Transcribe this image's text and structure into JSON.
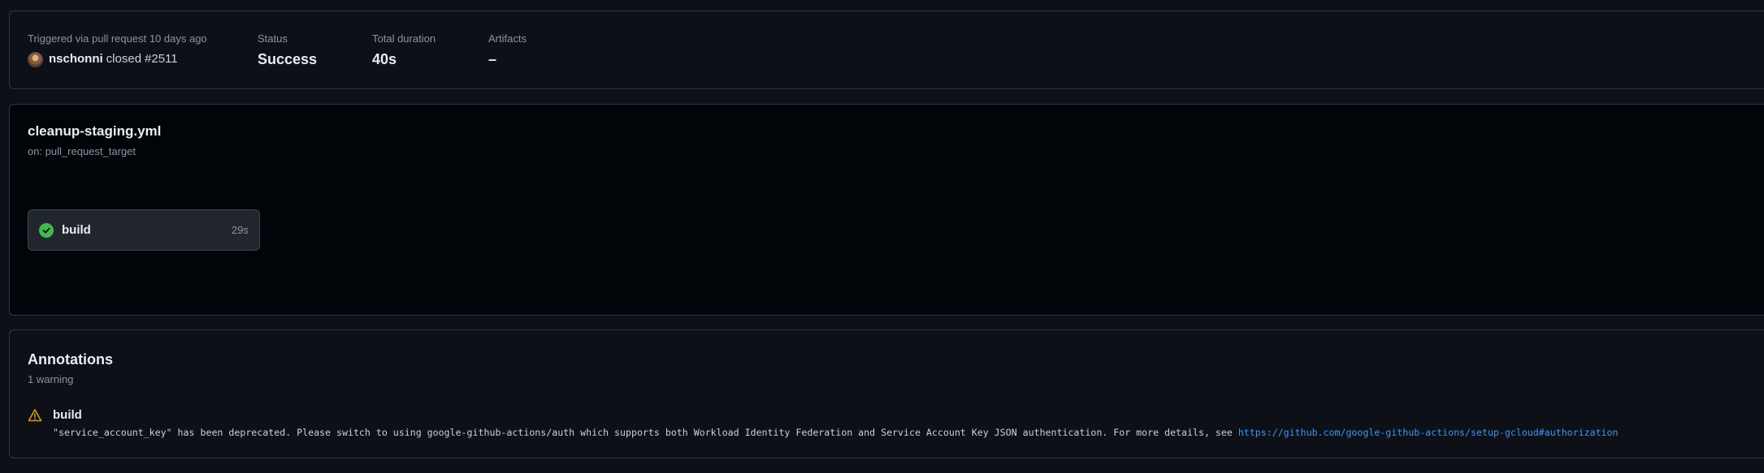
{
  "summary": {
    "trigger_label": "Triggered via pull request 10 days ago",
    "actor": "nschonni",
    "action": "closed",
    "pr_ref": "#2511",
    "status_label": "Status",
    "status_value": "Success",
    "duration_label": "Total duration",
    "duration_value": "40s",
    "artifacts_label": "Artifacts",
    "artifacts_value": "–"
  },
  "workflow": {
    "file_name": "cleanup-staging.yml",
    "trigger": "on: pull_request_target",
    "jobs": [
      {
        "name": "build",
        "duration": "29s",
        "status": "success",
        "icon": "check-circle-fill-icon"
      }
    ]
  },
  "annotations": {
    "title": "Annotations",
    "count": "1 warning",
    "items": [
      {
        "type": "warning",
        "icon": "alert-triangle-icon",
        "job": "build",
        "message": "\"service_account_key\" has been deprecated. Please switch to using google-github-actions/auth which supports both Workload Identity Federation and Service Account Key JSON authentication. For more details, see ",
        "link": "https://github.com/google-github-actions/setup-gcloud#authorization"
      }
    ]
  },
  "colors": {
    "background": "#0d1117",
    "graph_background": "#010409",
    "border": "#30363d",
    "success": "#3fb950",
    "warning": "#d29922",
    "link": "#4493f8"
  }
}
